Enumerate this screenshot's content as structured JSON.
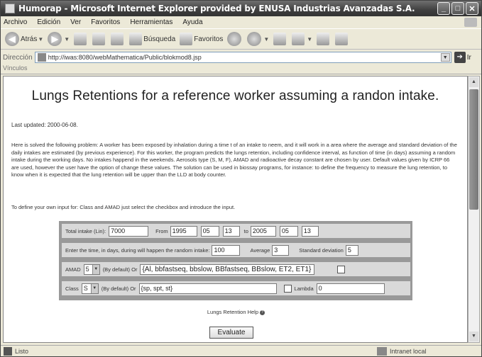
{
  "window": {
    "title": "Humorap - Microsoft Internet Explorer provided by ENUSA Industrias Avanzadas S.A.",
    "controls": [
      "_",
      "□",
      "✕"
    ]
  },
  "menu": [
    "Archivo",
    "Edición",
    "Ver",
    "Favoritos",
    "Herramientas",
    "Ayuda"
  ],
  "toolbar": {
    "back": "Atrás",
    "search": "Búsqueda",
    "favorites": "Favoritos"
  },
  "address": {
    "label": "Dirección",
    "url": "http://iwas:8080/webMathematica/Public/blokmod8.jsp",
    "go": "Ir"
  },
  "links_label": "Vínculos",
  "page": {
    "title": "Lungs Retentions for a reference worker assuming a randon intake.",
    "updated": "Last updated: 2000-06-08.",
    "description": "Here is solved the following problem: A worker has been exposed by inhalation during a time t of an intake to neem, and it will work in a area where the average and standard deviation of the daily intakes are estimated (by previous experience). For this worker, the program predicts the lungs retention, including confidence interval, as function of time (in days) assuming a random intake during the working days. No intakes happend in the weekends. Aerosols type (S, M, F), AMAD and radioactive decay constant are chosen by user. Default values given by ICRP 66 are used, however the user have the option of change these values. The solution can be used in biossay programs, for instance: to define the frequency to measure the lung retention, to know when it is expected that the lung retention will be upper than the LLD at body counter.",
    "instruction": "To define your own input for: Class and AMAD just select the checkbox and introduce the input.",
    "form": {
      "total_intake_label": "Total intake (Lin):",
      "total_intake": "7000",
      "from_label": "From",
      "from_year": "1995",
      "from_month": "05",
      "from_day": "13",
      "to_label": "to",
      "to_year": "2005",
      "to_month": "05",
      "to_day": "13",
      "days_label": "Enter the time, in days, during will happen the random intake:",
      "days": "100",
      "average_label": "Average",
      "average": "3",
      "stddev_label": "Standard deviation",
      "stddev": "5",
      "amad_label": "AMAD",
      "amad_value": "5",
      "amad_default_label": "(By default) Or",
      "amad_custom": "{Al, bbfastseq, bbslow, BBfastseq, BBslow, ET2, ET1}",
      "class_label": "Class",
      "class_value": "S",
      "class_default_label": "(By default) Or",
      "class_custom": "{sp, spt, st}",
      "lambda_label": "Lambda",
      "lambda_value": "0"
    },
    "help_label": "Lungs Retention Help",
    "evaluate_label": "Evaluate"
  },
  "status": {
    "left": "Listo",
    "zone": "Intranet local"
  }
}
